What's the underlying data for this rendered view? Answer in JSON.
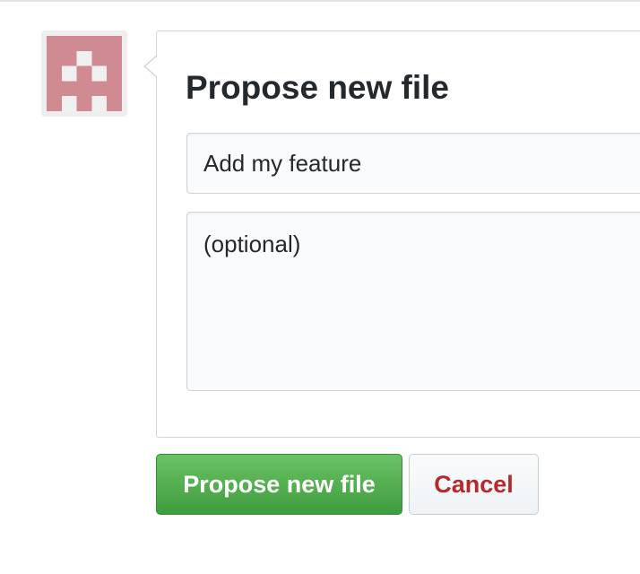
{
  "avatar": {
    "icon": "identicon-avatar",
    "color": "#d08a91"
  },
  "panel": {
    "title": "Propose new file",
    "commit_summary": {
      "value": "Add my feature",
      "placeholder": "Add my feature"
    },
    "description": {
      "value": "",
      "placeholder": "(optional)"
    }
  },
  "actions": {
    "submit_label": "Propose new file",
    "cancel_label": "Cancel"
  },
  "colors": {
    "primary": "#4caf50",
    "cancel_text": "#b5292d",
    "border": "#d1d5da",
    "input_bg": "#fafbfc"
  }
}
